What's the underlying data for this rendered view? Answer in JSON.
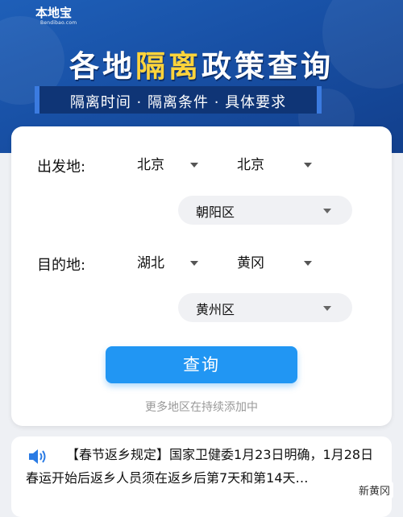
{
  "banner": {
    "logo_main": "本地宝",
    "logo_sub": "Bendibao.com",
    "title_part1": "各地",
    "title_highlight": "隔离",
    "title_part2": "政策查询",
    "subtitle": "隔离时间 · 隔离条件 · 具体要求"
  },
  "form": {
    "origin_label": "出发地:",
    "origin_province": "北京",
    "origin_city": "北京",
    "origin_district": "朝阳区",
    "dest_label": "目的地:",
    "dest_province": "湖北",
    "dest_city": "黄冈",
    "dest_district": "黄州区",
    "query_button": "查询",
    "hint": "更多地区在持续添加中"
  },
  "notice": {
    "icon": "speaker-icon",
    "text": "【春节返乡规定】国家卫健委1月23日明确，1月28日春运开始后返乡人员须在返乡后第7天和第14天…"
  },
  "watermark": "新黄冈",
  "colors": {
    "banner": "#1850a5",
    "highlight": "#ffd43b",
    "button": "#2196f3"
  }
}
